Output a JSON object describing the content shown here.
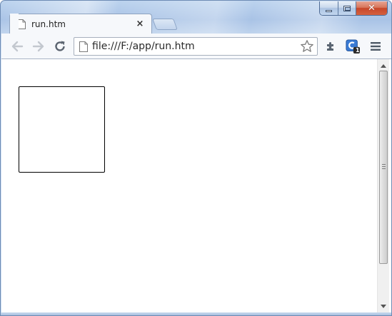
{
  "window": {
    "caption_buttons": {
      "minimize": "minimize-icon",
      "maximize": "maximize-icon",
      "close": "close-icon"
    }
  },
  "tab": {
    "title": "run.htm",
    "close_glyph": "×"
  },
  "toolbar": {
    "back_icon": "back-arrow-icon",
    "forward_icon": "forward-arrow-icon",
    "reload_icon": "reload-icon",
    "url": "file:///F:/app/run.htm",
    "bookmark_icon": "star-icon",
    "extension_icons": [
      "puzzle-icon",
      "extension-badge-icon"
    ],
    "extension_badge_count": "1",
    "menu_icon": "hamburger-menu-icon"
  },
  "colors": {
    "frame": "#bcd3ee",
    "close_button": "#c7462a",
    "toolbar": "#f6f8fb",
    "extension_icon": "#3a7bd5"
  }
}
